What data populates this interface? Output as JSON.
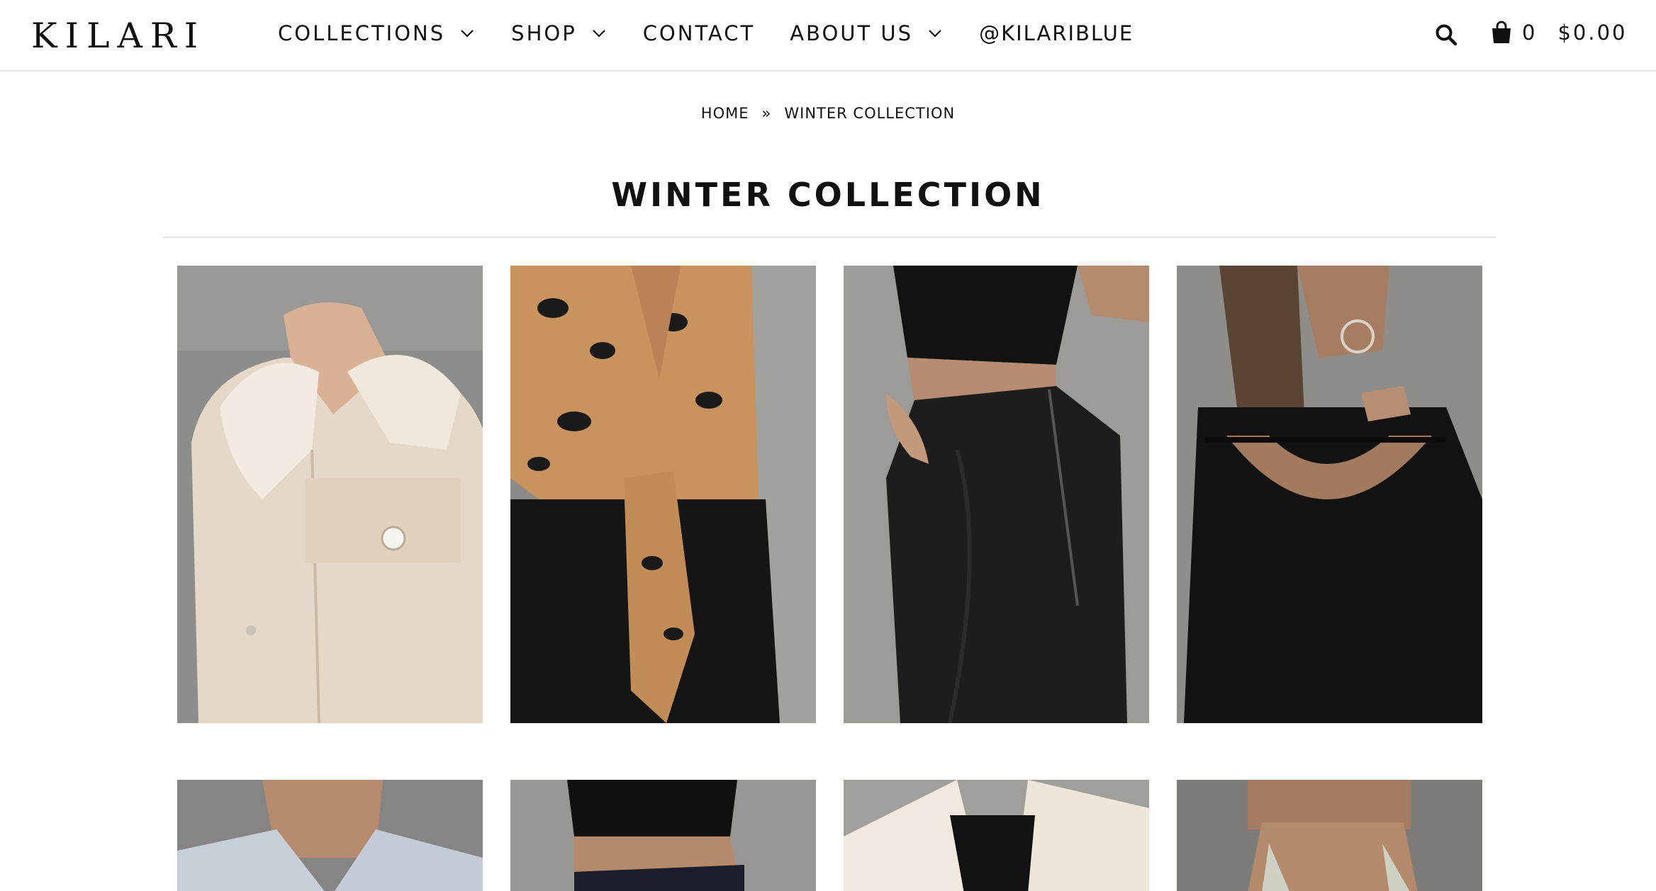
{
  "brand": {
    "logo_text": "KILARI"
  },
  "nav": {
    "items": [
      {
        "label": "COLLECTIONS",
        "has_dropdown": true
      },
      {
        "label": "SHOP",
        "has_dropdown": true
      },
      {
        "label": "CONTACT",
        "has_dropdown": false
      },
      {
        "label": "ABOUT US",
        "has_dropdown": true
      },
      {
        "label": "@KILARIBLUE",
        "has_dropdown": false
      }
    ]
  },
  "header_tools": {
    "search_icon": "search-icon",
    "cart_icon": "shopping-bag-icon",
    "cart_count": "0",
    "cart_total": "$0.00"
  },
  "breadcrumb": {
    "home": "HOME",
    "separator": "»",
    "current": "WINTER COLLECTION"
  },
  "page": {
    "title": "WINTER COLLECTION"
  },
  "products": [
    {
      "image": "sherpa-collar-corduroy-jacket"
    },
    {
      "image": "leopard-print-tie-front-top"
    },
    {
      "image": "faux-leather-side-zip-pants"
    },
    {
      "image": "black-open-back-knit-sweater"
    },
    {
      "image": "light-blue-blazer"
    },
    {
      "image": "black-crop-top-pinstripe-pants"
    },
    {
      "image": "cream-blazer-black-tube-top"
    },
    {
      "image": "sage-knit-tank"
    }
  ],
  "colors": {
    "text": "#111111",
    "divider": "#e2e2e2",
    "background": "#ffffff"
  }
}
